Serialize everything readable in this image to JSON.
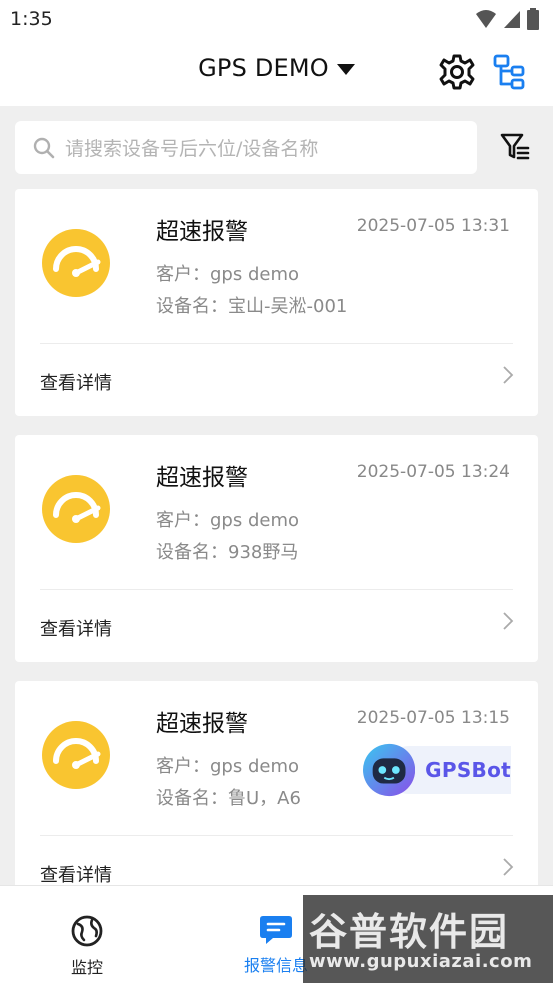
{
  "status_bar": {
    "time": "1:35"
  },
  "header": {
    "title": "GPS DEMO"
  },
  "search": {
    "placeholder": "请搜索设备号后六位/设备名称"
  },
  "alarms": [
    {
      "title": "超速报警",
      "time": "2025-07-05 13:31",
      "customer": "客户：gps demo",
      "device": "设备名：宝山-吴淞-001",
      "detail": "查看详情"
    },
    {
      "title": "超速报警",
      "time": "2025-07-05 13:24",
      "customer": "客户：gps demo",
      "device": "设备名：938野马",
      "detail": "查看详情"
    },
    {
      "title": "超速报警",
      "time": "2025-07-05 13:15",
      "customer": "客户：gps demo",
      "device": "设备名：鲁U，A6",
      "detail": "查看详情"
    }
  ],
  "gpsbot": {
    "label": "GPSBot"
  },
  "nav": {
    "items": [
      {
        "label": "监控"
      },
      {
        "label": "报警信息"
      }
    ]
  },
  "watermark": {
    "title": "谷普软件园",
    "url": "www.gupuxiazai.com"
  },
  "colors": {
    "accent": "#1a7ff0",
    "alarm_yellow": "#f9c530",
    "background": "#efefef"
  }
}
